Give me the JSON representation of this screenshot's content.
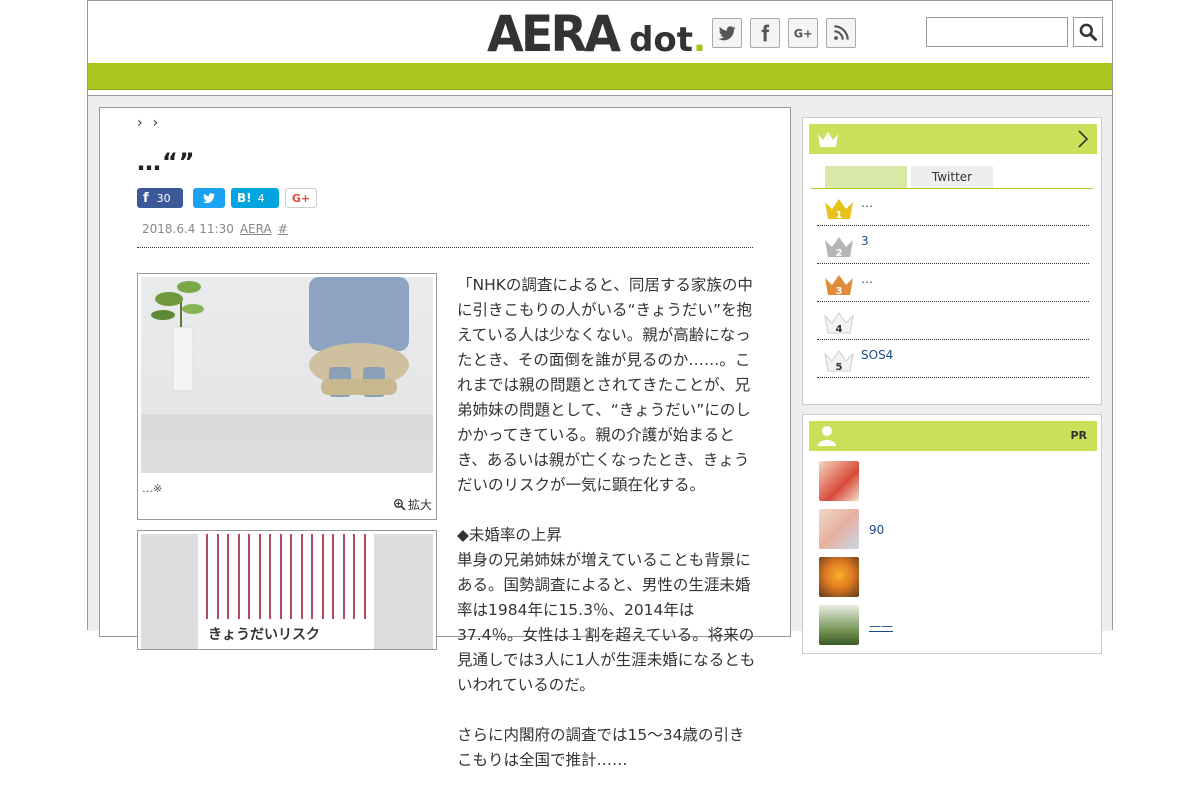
{
  "header": {
    "logo_main": "AERA",
    "logo_sub": "dot",
    "logo_period": ".",
    "search": {
      "placeholder": "",
      "value": ""
    }
  },
  "social_icons": [
    "twitter-icon",
    "facebook-icon",
    "google-plus-icon",
    "rss-icon"
  ],
  "colors": {
    "brand_green": "#a9c71f",
    "sidebar_head": "#c8e05a",
    "link": "#1a4a8a"
  },
  "article": {
    "breadcrumb": [
      "›",
      "›"
    ],
    "title": "…“”",
    "share": {
      "facebook_count": "30",
      "hatena_label": "B!",
      "hatena_count": "4",
      "gplus_label": "G+"
    },
    "meta": {
      "date": "2018.6.4 11:30",
      "source": "AERA",
      "tag": "#"
    },
    "photo_caption": "…※",
    "zoom_label": "拡大",
    "book_cover_text": "きょうだいリスク",
    "paragraphs": [
      "「NHKの調査によると、同居する家族の中に引きこもりの人がいる“きょうだい”を抱えている人は少なくない。親が高齢になったとき、その面倒を誰が見るのか……。これまでは親の問題とされてきたことが、兄弟姉妹の問題として、“きょうだい”にのしかかってきている。親の介護が始まるとき、あるいは親が亡くなったとき、きょうだいのリスクが一気に顕在化する。",
      "◆未婚率の上昇\n単身の兄弟姉妹が増えていることも背景にある。国勢調査によると、男性の生涯未婚率は1984年に15.3％、2014年は37.4％。女性は１割を超えている。将来の見通しでは3人に1人が生涯未婚になるともいわれているのだ。",
      "さらに内閣府の調査では15〜34歳の引きこもりは全国で推計……"
    ]
  },
  "ranking": {
    "tabs": [
      "",
      "Twitter"
    ],
    "items": [
      {
        "rank": "1",
        "text": "…"
      },
      {
        "rank": "2",
        "text": "3"
      },
      {
        "rank": "3",
        "text": "…"
      },
      {
        "rank": "4",
        "text": ""
      },
      {
        "rank": "5",
        "text": "SOS4"
      }
    ]
  },
  "pr": {
    "label": "PR",
    "items": [
      {
        "text": ""
      },
      {
        "text": "90"
      },
      {
        "text": ""
      },
      {
        "text": "——"
      }
    ]
  }
}
